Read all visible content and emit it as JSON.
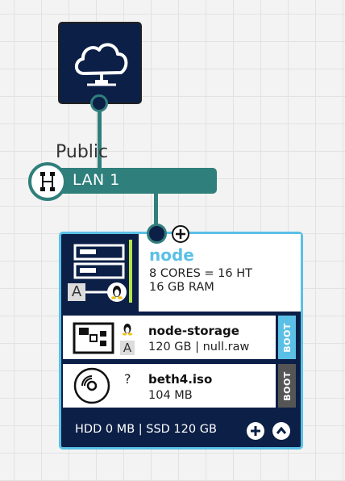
{
  "network": {
    "internet_icon": "cloud-network-icon",
    "label": "Public",
    "lan_label": "LAN 1",
    "lan_icon": "network-hub-icon"
  },
  "server": {
    "name": "node",
    "cores": "8 CORES = 16 HT",
    "ram": "16 GB RAM",
    "icon": "server-icon",
    "os_icon": "linux-icon",
    "badge": "A",
    "status_color": "#b6e34a",
    "accent_color": "#5bc0e6",
    "teal_color": "#2f7f7c"
  },
  "drives": [
    {
      "name": "node-storage",
      "meta": "120 GB | null.raw",
      "icon": "hard-drive-icon",
      "os_icon": "linux-icon",
      "badge": "A",
      "boot_label": "BOOT",
      "boot_color": "#5bc0e6"
    },
    {
      "name": "beth4.iso",
      "meta": "104 MB",
      "icon": "cdrom-icon",
      "os_icon": "?",
      "boot_label": "BOOT",
      "boot_color": "#555555"
    }
  ],
  "storage": {
    "summary": "HDD 0 MB | SSD 120 GB"
  }
}
